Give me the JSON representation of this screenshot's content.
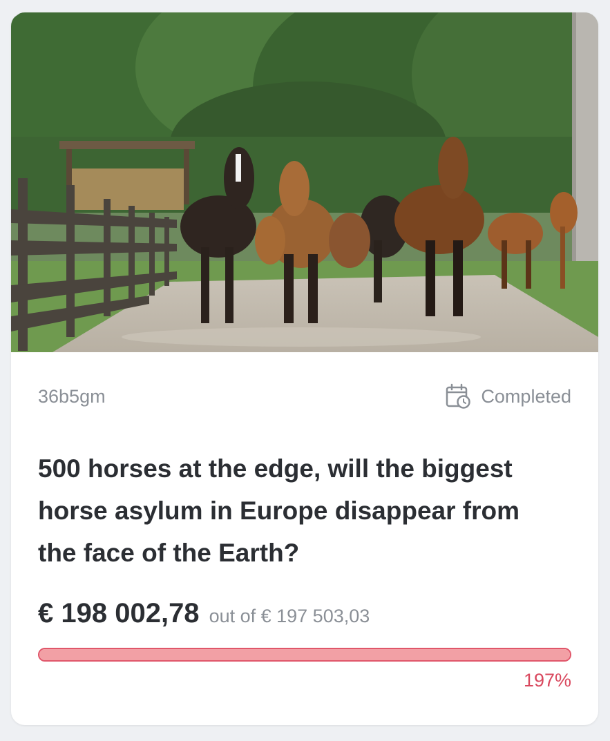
{
  "campaign": {
    "image_alt": "Herd of horses walking along a dirt path by wooden fences",
    "id_code": "36b5gm",
    "status_icon": "calendar-clock-icon",
    "status_label": "Completed",
    "title": "500 horses at the edge, will the biggest horse asylum in Europe disappear from the face of the Earth?",
    "raised": "€ 198 002,78",
    "goal_text": "out of € 197 503,03",
    "progress_fraction": 1.0,
    "percent_label": "197%"
  },
  "colors": {
    "accent": "#e0566a",
    "progress_fill": "#f2a0a5",
    "percent_text": "#d9485e",
    "title_text": "#2b2e33",
    "muted_text": "#8a8f96"
  }
}
